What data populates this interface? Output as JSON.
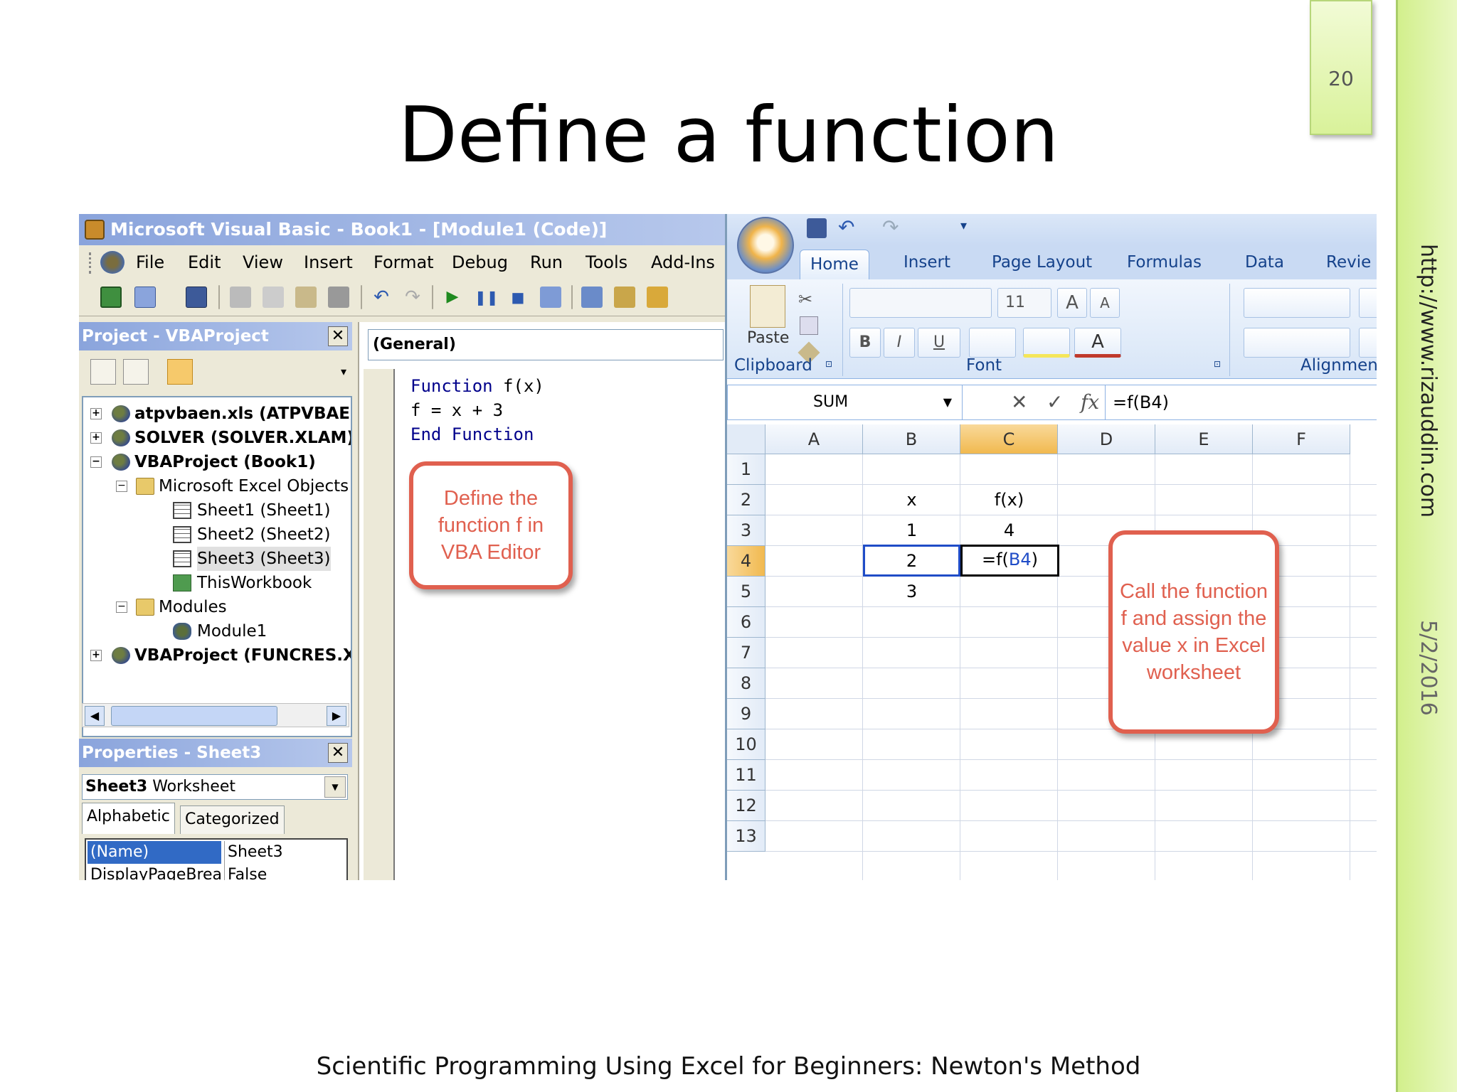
{
  "slide": {
    "number": "20",
    "title": "Define a function",
    "footer": "Scientific Programming Using Excel for Beginners: Newton's Method",
    "side_url": "http://www.rizauddin.com",
    "side_date": "5/2/2016"
  },
  "vba": {
    "window_title": "Microsoft Visual Basic - Book1 - [Module1 (Code)]",
    "menu": [
      "File",
      "Edit",
      "View",
      "Insert",
      "Format",
      "Debug",
      "Run",
      "Tools",
      "Add-Ins"
    ],
    "project_panel_title": "Project - VBAProject",
    "tree": [
      {
        "label": "atpvbaen.xls (ATPVBAEN",
        "bold": true,
        "expander": "+"
      },
      {
        "label": "SOLVER (SOLVER.XLAM)",
        "bold": true,
        "expander": "+"
      },
      {
        "label": "VBAProject (Book1)",
        "bold": true,
        "expander": "−"
      },
      {
        "label": "Microsoft Excel Objects",
        "bold": false,
        "expander": "−"
      },
      {
        "label": "Sheet1 (Sheet1)",
        "bold": false
      },
      {
        "label": "Sheet2 (Sheet2)",
        "bold": false
      },
      {
        "label": "Sheet3 (Sheet3)",
        "bold": false
      },
      {
        "label": "ThisWorkbook",
        "bold": false
      },
      {
        "label": "Modules",
        "bold": false,
        "expander": "−"
      },
      {
        "label": "Module1",
        "bold": false
      },
      {
        "label": "VBAProject (FUNCRES.XL",
        "bold": true,
        "expander": "+"
      }
    ],
    "properties_panel_title": "Properties - Sheet3",
    "object_combo_name": "Sheet3",
    "object_combo_type": "Worksheet",
    "tabs": [
      "Alphabetic",
      "Categorized"
    ],
    "properties": [
      {
        "key": "(Name)",
        "value": "Sheet3"
      },
      {
        "key": "DisplayPageBreak",
        "value": "False"
      }
    ],
    "general_combo": "(General)",
    "code": [
      {
        "kw": "Function",
        "rest": " f(x)"
      },
      {
        "kw": "",
        "rest": "f = x + 3"
      },
      {
        "kw": "End Function",
        "rest": ""
      }
    ],
    "callout": "Define the function f in VBA Editor"
  },
  "excel": {
    "ribbon_tabs": [
      "Home",
      "Insert",
      "Page Layout",
      "Formulas",
      "Data",
      "Revie"
    ],
    "paste_label": "Paste",
    "groups": [
      "Clipboard",
      "Font",
      "Alignment"
    ],
    "font_size": "11",
    "font_buttons": [
      "B",
      "I",
      "U"
    ],
    "name_box": "SUM",
    "formula": "=f(B4)",
    "fx_symbols": {
      "cancel": "✕",
      "enter": "✓",
      "fx": "fx"
    },
    "columns": [
      "A",
      "B",
      "C",
      "D",
      "E",
      "F"
    ],
    "rows": [
      "1",
      "2",
      "3",
      "4",
      "5",
      "6",
      "7",
      "8",
      "9",
      "10",
      "11",
      "12",
      "13"
    ],
    "cells": {
      "B2": "x",
      "C2": "f(x)",
      "B3": "1",
      "C3": "4",
      "B4": "2",
      "B5": "3"
    },
    "active_cell_prefix": "=f(",
    "active_cell_ref": "B4",
    "active_cell_suffix": ")",
    "callout": "Call the function f and assign the value x in Excel worksheet"
  }
}
